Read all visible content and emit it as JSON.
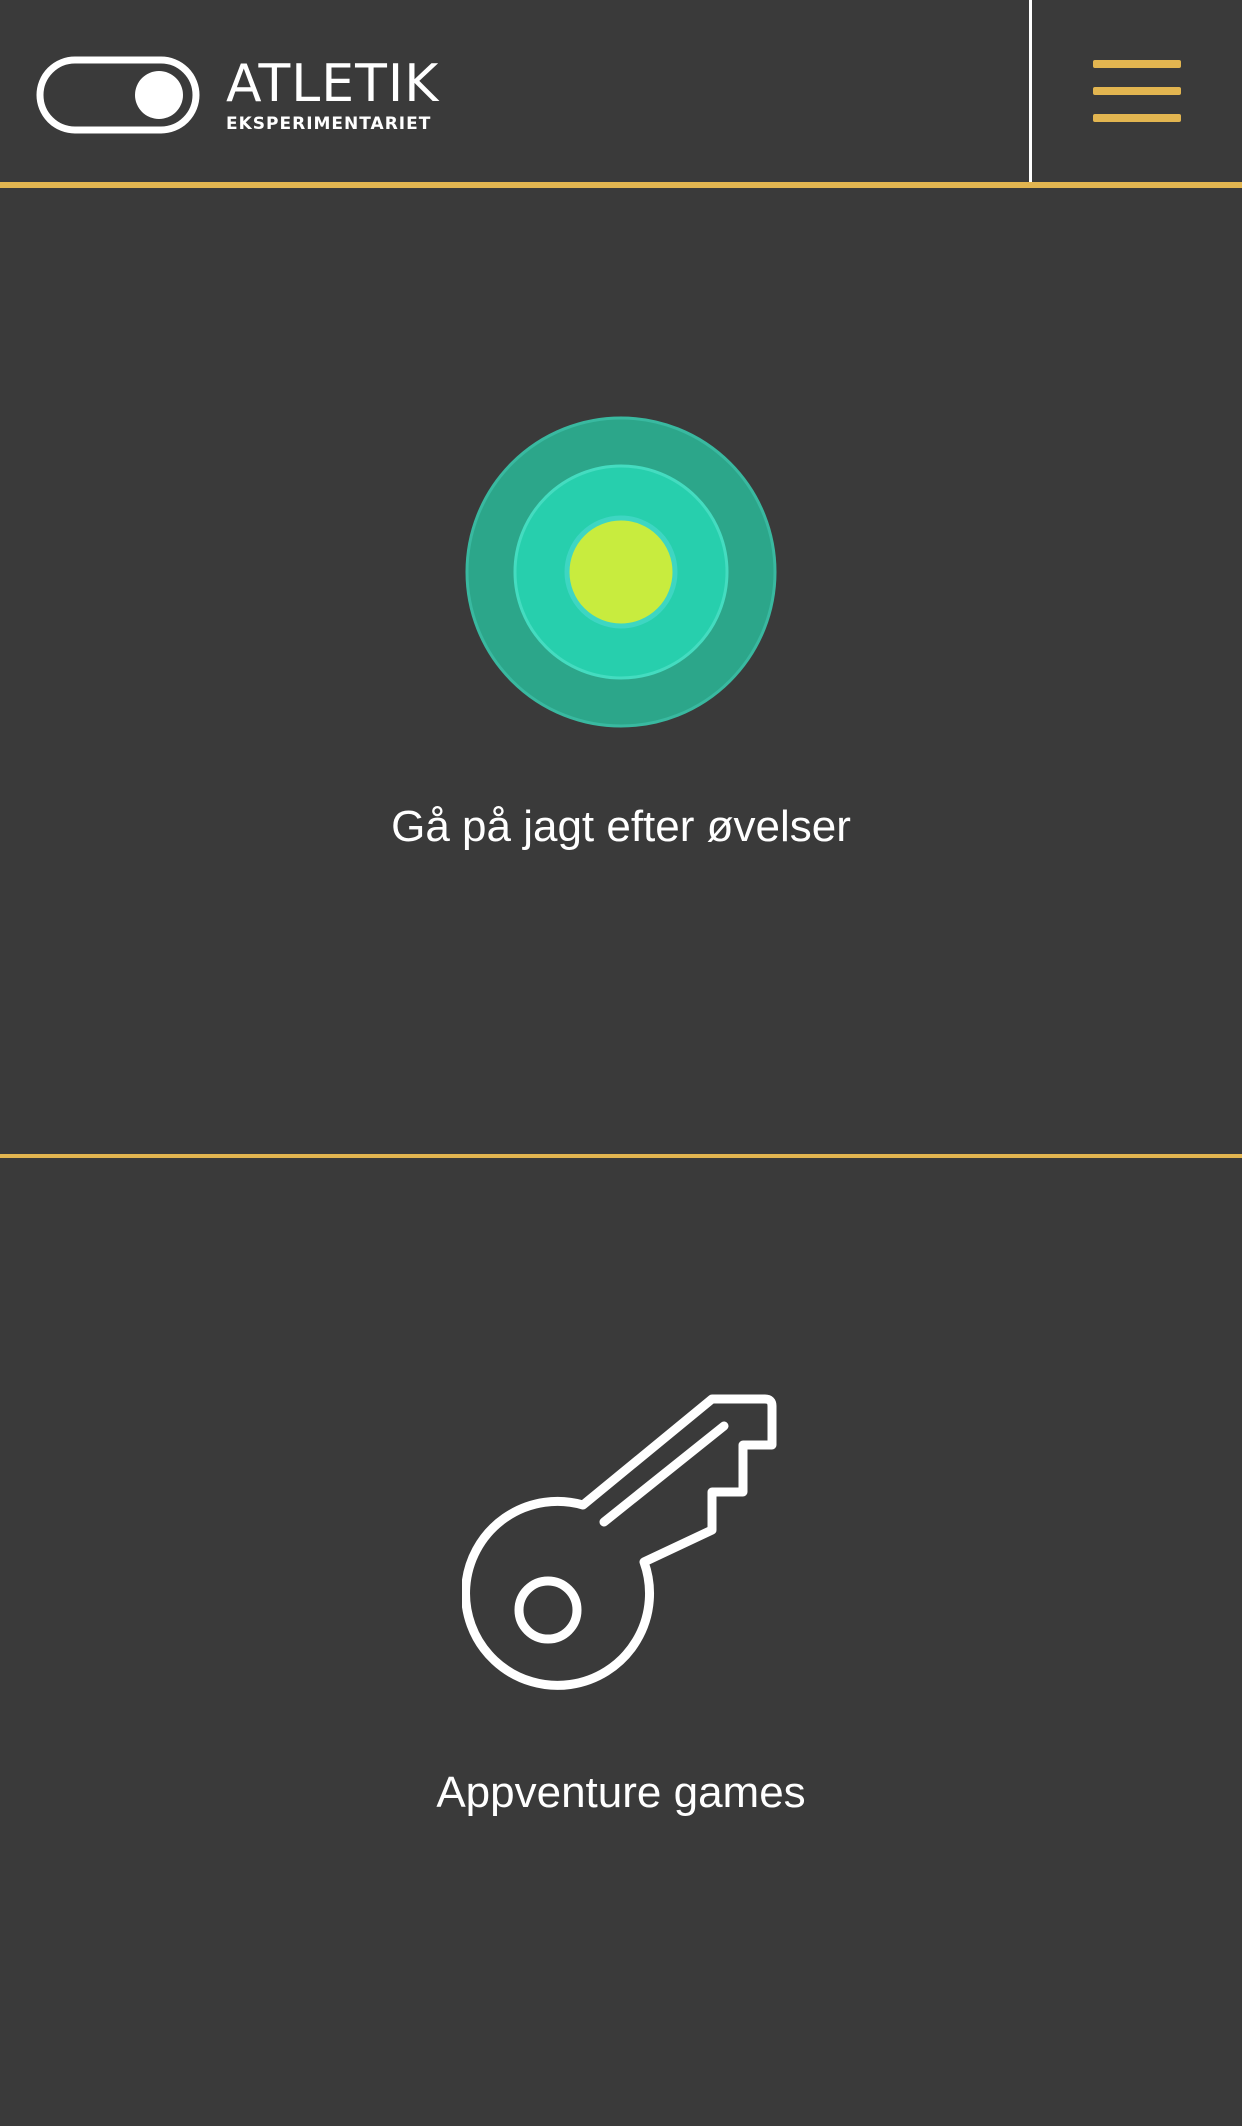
{
  "header": {
    "logo": {
      "title": "ATLETIK",
      "subtitle": "EKSPERIMENTARIET"
    },
    "menu_icon": "hamburger-menu-icon"
  },
  "sections": [
    {
      "label": "Gå på jagt efter øvelser",
      "icon": "target-radar-icon"
    },
    {
      "label": "Appventure games",
      "icon": "key-icon"
    }
  ],
  "colors": {
    "background": "#3a3a3a",
    "accent": "#e2b550",
    "target_outer": "#2ca68a",
    "target_middle": "#27cfad",
    "target_center": "#c8ec3e",
    "text": "#ffffff"
  }
}
